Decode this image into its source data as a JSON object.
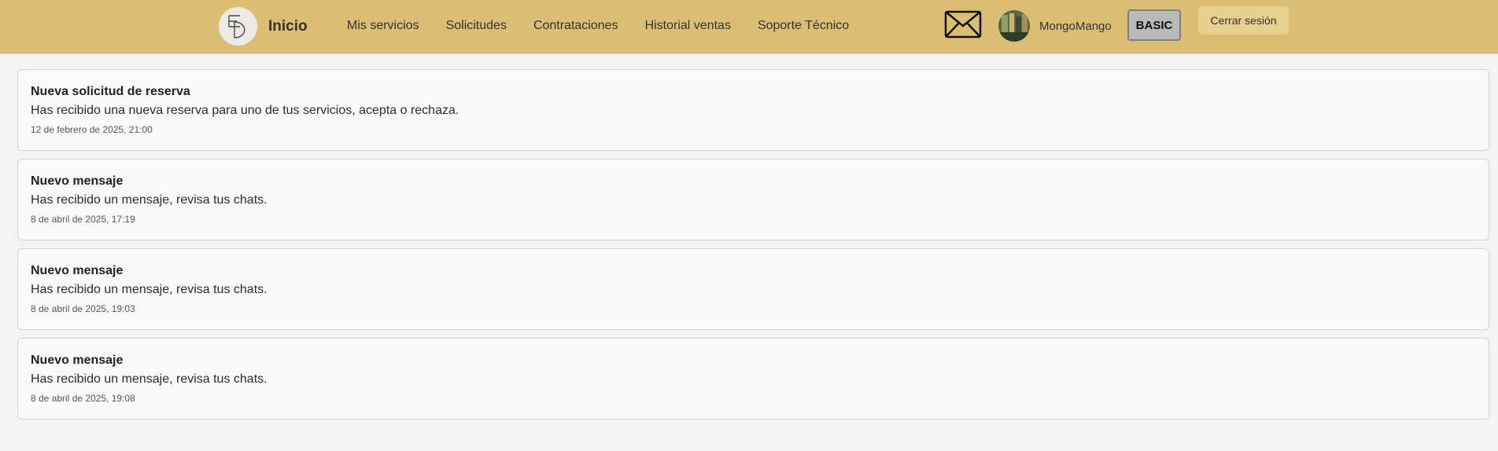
{
  "header": {
    "brand": {
      "title": "Inicio"
    },
    "nav": [
      {
        "label": "Mis servicios"
      },
      {
        "label": "Solicitudes"
      },
      {
        "label": "Contrataciones"
      },
      {
        "label": "Historial ventas"
      },
      {
        "label": "Soporte Técnico"
      }
    ],
    "mail_icon": "envelope-icon",
    "user": {
      "name": "MongoMango",
      "plan": "BASIC"
    },
    "logout_label": "Cerrar sesión"
  },
  "notifications": [
    {
      "title": "Nueva solicitud de reserva",
      "message": "Has recibido una nueva reserva para uno de tus servicios, acepta o rechaza.",
      "date": "12 de febrero de 2025, 21:00"
    },
    {
      "title": "Nuevo mensaje",
      "message": "Has recibido un mensaje, revisa tus chats.",
      "date": "8 de abril de 2025, 17:19"
    },
    {
      "title": "Nuevo mensaje",
      "message": "Has recibido un mensaje, revisa tus chats.",
      "date": "8 de abril de 2025, 19:03"
    },
    {
      "title": "Nuevo mensaje",
      "message": "Has recibido un mensaje, revisa tus chats.",
      "date": "8 de abril de 2025, 19:08"
    }
  ],
  "colors": {
    "header_bg": "#dbbe74",
    "logout_bg": "#e7cf8d",
    "plan_bg": "#b9b9b9",
    "page_bg": "#f3f3f3",
    "card_bg": "#fafafa"
  }
}
